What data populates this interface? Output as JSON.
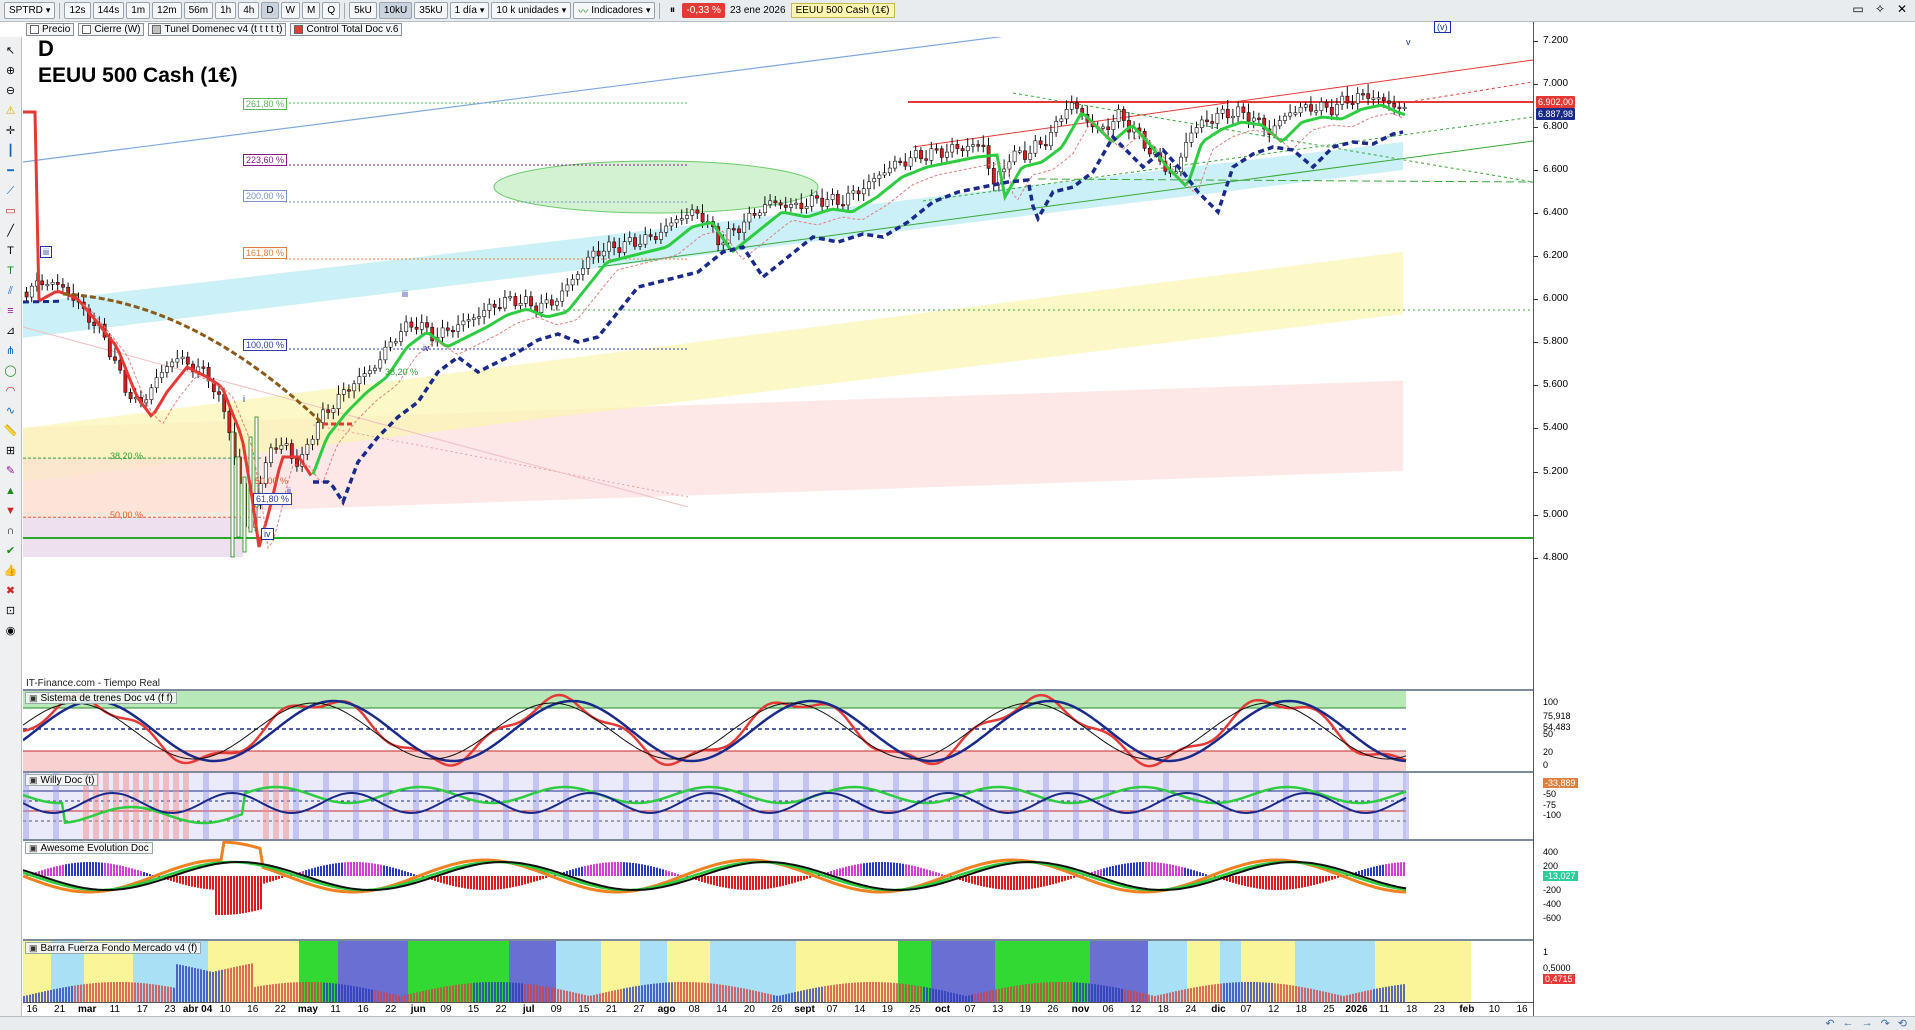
{
  "toolbar": {
    "symbol": "SPTRD",
    "timeframes": [
      "12s",
      "144s",
      "1m",
      "12m",
      "56m",
      "1h",
      "4h",
      "D",
      "W",
      "M",
      "Q"
    ],
    "volume_modes": [
      "5kU",
      "10kU",
      "35kU"
    ],
    "interval": "1 día",
    "units": "10 k unidades",
    "indicators": "Indicadores",
    "change": "-0,33 %",
    "date": "23 ene 2026",
    "instrument_tag": "EEUU 500 Cash (1€)"
  },
  "legend": [
    {
      "label": "Precio",
      "color": "#ffffff"
    },
    {
      "label": "Cierre (W)",
      "color": "#ffffff"
    },
    {
      "label": "Tunel Domenec v4 (t t t t t)",
      "color": "#c0c0c0"
    },
    {
      "label": "Control Total Doc v.6",
      "color": "#e53935"
    }
  ],
  "chart": {
    "timeframe_letter": "D",
    "instrument": "EEUU 500 Cash (1€)",
    "source": "IT-Finance.com - Tiempo Real"
  },
  "fibs": [
    {
      "label": "261,80 %",
      "color": "#58b858"
    },
    {
      "label": "223,60 %",
      "color": "#8a1a8a"
    },
    {
      "label": "200,00 %",
      "color": "#7a94c8"
    },
    {
      "label": "161,80 %",
      "color": "#e08040"
    },
    {
      "label": "100,00 %",
      "color": "#2f3fb0"
    },
    {
      "label": "38,20 %",
      "color": "#38a038"
    },
    {
      "label": "38,20 %",
      "color": "#38a038"
    },
    {
      "label": "50,00 %",
      "color": "#e06030"
    },
    {
      "label": "50,00 %",
      "color": "#e06030"
    },
    {
      "label": "61,80 %",
      "color": "#2f3fb0"
    }
  ],
  "waves": {
    "iii_box": "iii",
    "iii": "iii",
    "i": "i",
    "ii": "ii",
    "iv_box": "iv",
    "v_box": "(v)",
    "v": "v",
    "iv_small": "iv"
  },
  "price_axis": {
    "labels": [
      "7.200",
      "7.000",
      "6.800",
      "6.600",
      "6.400",
      "6.200",
      "6.000",
      "5.800",
      "5.600",
      "5.400",
      "5.200",
      "5.000",
      "4.800"
    ],
    "tags": [
      {
        "text": "6.902,00",
        "bg": "#e53935",
        "color": "#ffffff"
      },
      {
        "text": "6.887,98",
        "bg": "#1a2a8a",
        "color": "#ffffff"
      }
    ]
  },
  "panes": {
    "trenes": {
      "title": "Sistema de trenes Doc v4 (f f)",
      "axis": [
        "100",
        "75,918",
        "54,483",
        "50",
        "20",
        "0"
      ]
    },
    "willy": {
      "title": "Willy Doc (t)",
      "axis": [
        "-33,889",
        "-50",
        "-75",
        "-100"
      ]
    },
    "awesome": {
      "title": "Awesome Evolution Doc",
      "axis": [
        "400",
        "200",
        "-13,027",
        "-200",
        "-400",
        "-600"
      ]
    },
    "barra": {
      "title": "Barra Fuerza Fondo Mercado v4 (f)",
      "axis": [
        "1",
        "0,5000",
        "0,4715"
      ]
    }
  },
  "time_axis": {
    "labels": [
      "16",
      "21",
      "mar",
      "11",
      "17",
      "23",
      "abr 04",
      "10",
      "16",
      "22",
      "may",
      "11",
      "16",
      "22",
      "jun",
      "09",
      "15",
      "22",
      "jul",
      "09",
      "15",
      "21",
      "27",
      "ago",
      "08",
      "14",
      "20",
      "26",
      "sept",
      "07",
      "14",
      "19",
      "25",
      "oct",
      "07",
      "13",
      "19",
      "26",
      "nov",
      "06",
      "12",
      "18",
      "24",
      "dic",
      "07",
      "12",
      "18",
      "25",
      "2026",
      "11",
      "18",
      "23",
      "feb",
      "10",
      "16"
    ],
    "months": [
      "mar",
      "abr 04",
      "may",
      "jun",
      "jul",
      "ago",
      "sept",
      "oct",
      "nov",
      "dic",
      "2026",
      "feb"
    ]
  },
  "colors": {
    "up_candle": "#ffffff",
    "down_candle": "#d81b20",
    "ma_green": "#2ecc40",
    "ma_red": "#e53935",
    "ma_blue_dashed": "#1a2a8a",
    "ma_brown": "#8a5a1a",
    "accent": "#1565c0"
  }
}
